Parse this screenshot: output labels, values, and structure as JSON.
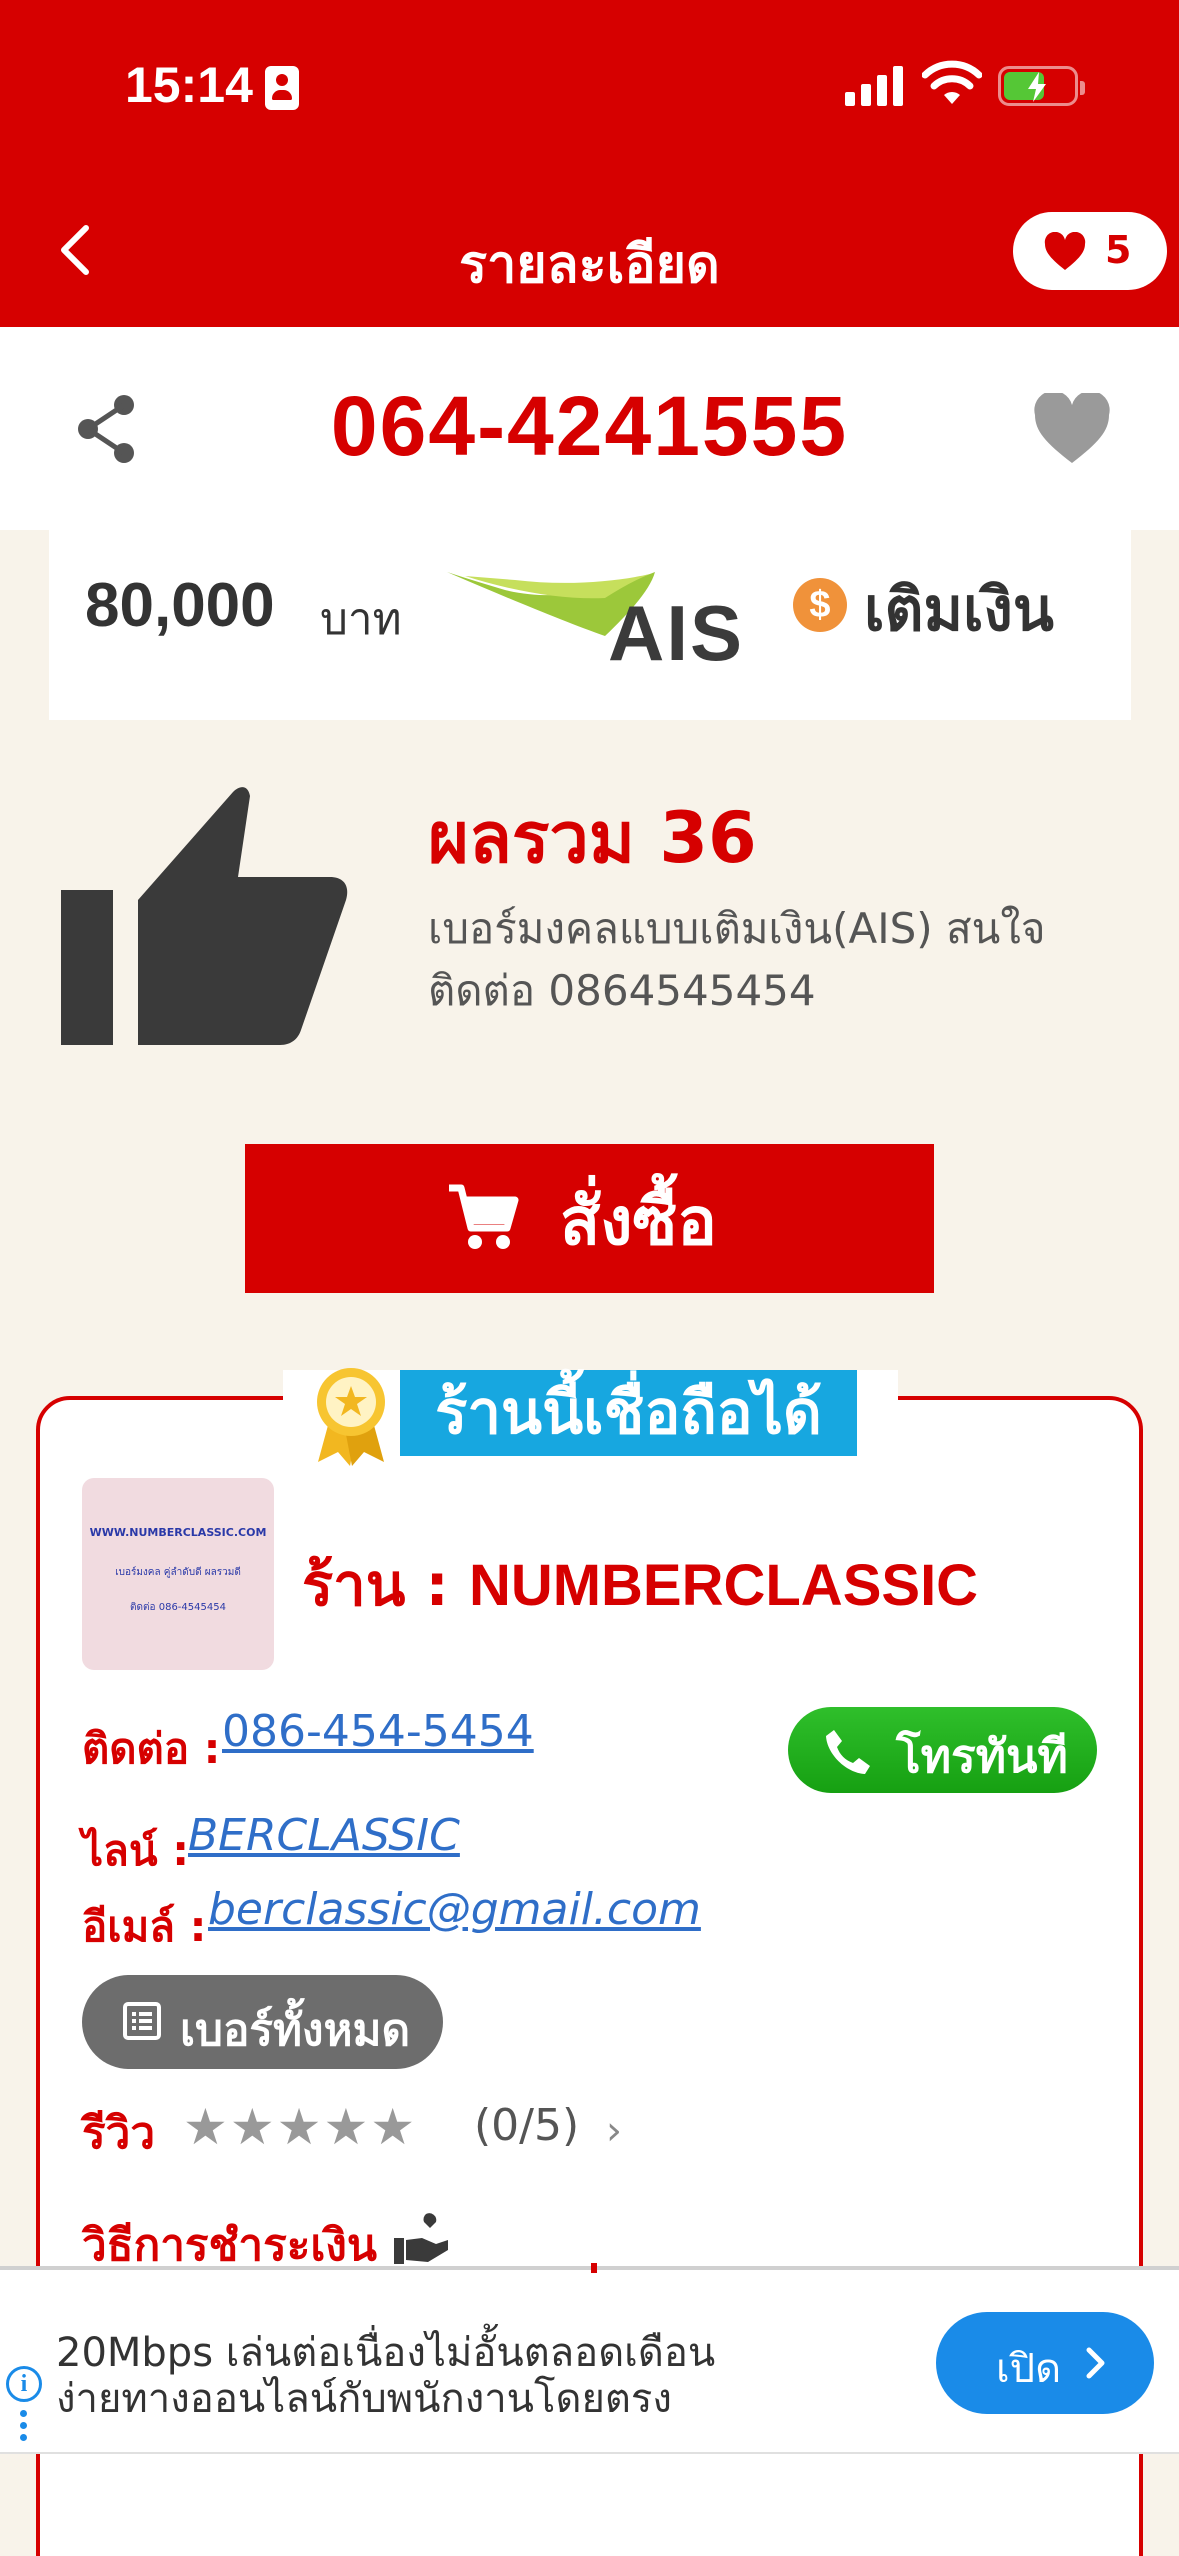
{
  "status_bar": {
    "time": "15:14"
  },
  "header": {
    "title": "รายละเอียด",
    "favorites_count": "5"
  },
  "number": {
    "value": "064-4241555"
  },
  "price": {
    "amount": "80,000",
    "unit": "บาท",
    "operator": "AIS",
    "coin_symbol": "$",
    "type": "เติมเงิน"
  },
  "summary": {
    "label": "ผลรวม 36",
    "description": "เบอร์มงคลแบบเติมเงิน(AIS) สนใจติดต่อ 0864545454"
  },
  "buy": {
    "label": "สั่งซื้อ"
  },
  "shop": {
    "trust_badge": "ร้านนี้เชื่อถือได้",
    "logo_lines": [
      "WWW.NUMBERCLASSIC.COM",
      "เบอร์มงคล คู่ลำดับดี ผลรวมดี",
      "ติดต่อ 086-4545454"
    ],
    "name_prefix": "ร้าน : ",
    "name": "NUMBERCLASSIC",
    "contact_label": "ติดต่อ :",
    "contact_value": "086-454-5454",
    "call_label": "โทรทันที",
    "line_label": "ไลน์ :",
    "line_value": "BERCLASSIC",
    "email_label": "อีเมล์ :",
    "email_value": "berclassic@gmail.com",
    "all_numbers_label": "เบอร์ทั้งหมด",
    "review_label": "รีวิว",
    "stars": "★★★★★",
    "rating": "(0/5)",
    "rating_value": 0,
    "payment_label": "วิธีการชำระเงิน"
  },
  "ad": {
    "line1": "20Mbps เล่นต่อเนื่องไม่อั้นตลอดเดือน",
    "line2": "ง่ายทางออนไลน์กับพนักงานโดยตรง",
    "open_label": "เปิด"
  },
  "colors": {
    "brand_red": "#d60000",
    "trust_blue": "#17a7e0",
    "call_green": "#1fae1b",
    "link_blue": "#2f6ec8",
    "ad_blue": "#1a8be8",
    "background": "#f8f3ea"
  }
}
